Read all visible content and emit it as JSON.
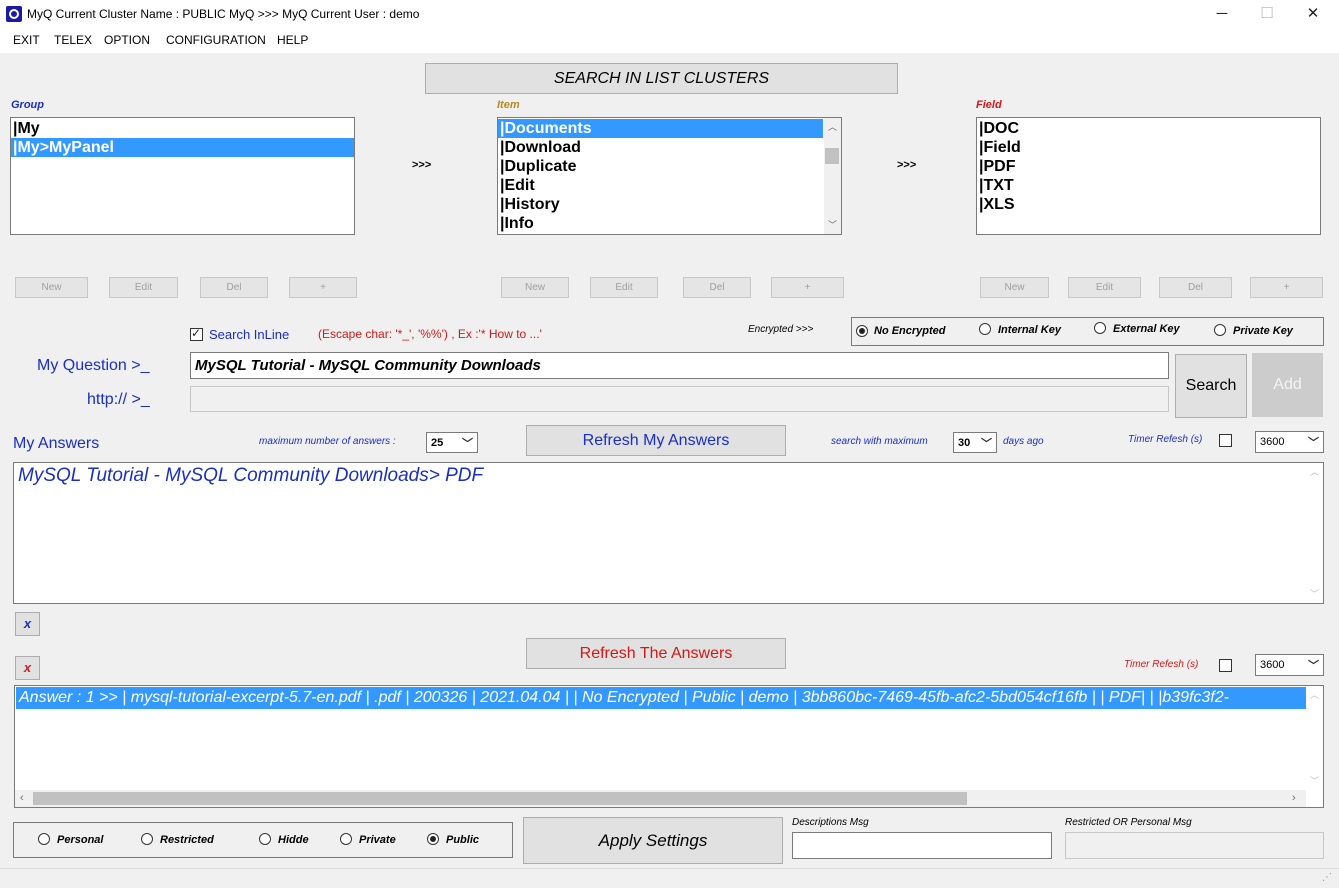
{
  "window": {
    "title": "MyQ Current Cluster Name : PUBLIC MyQ >>> MyQ Current User : demo",
    "minimize": "─",
    "maximize": "☐",
    "close": "✕"
  },
  "menu": [
    "EXIT",
    "TELEX",
    "OPTION",
    "CONFIGURATION",
    "HELP"
  ],
  "search_clusters_label": "SEARCH IN LIST CLUSTERS",
  "group": {
    "label": "Group",
    "items": [
      "|My",
      "|My>MyPanel"
    ],
    "selected": 1
  },
  "item": {
    "label": "Item",
    "items": [
      "|Documents",
      "|Download",
      "|Duplicate",
      "|Edit",
      "|History",
      "|Info"
    ],
    "selected": 0
  },
  "field": {
    "label": "Field",
    "items": [
      "|DOC",
      "|Field",
      "|PDF",
      "|TXT",
      "|XLS"
    ]
  },
  "arrow_sep": ">>>",
  "crud_buttons": [
    "New",
    "Edit",
    "Del",
    "+"
  ],
  "search_inline": {
    "label": "Search InLine",
    "checked": true,
    "hint": "(Escape char: '*_', '%%') , Ex :'* How to ...'"
  },
  "encryption": {
    "label": "Encrypted >>>",
    "options": [
      "No Encrypted",
      "Internal Key",
      "External Key",
      "Private Key"
    ],
    "selected": 0
  },
  "question": {
    "label": "My Question >_",
    "value": "MySQL Tutorial - MySQL Community Downloads"
  },
  "http": {
    "label": "http:// >_",
    "value": ""
  },
  "search_button": "Search",
  "add_button": "Add",
  "answers": {
    "label": "My Answers",
    "max_label": "maximum number of answers :",
    "max_value": "25",
    "refresh_label": "Refresh My Answers",
    "search_max_label": "search with maximum",
    "days_value": "30",
    "days_label": "days ago",
    "timer_label": "Timer Refesh (s)",
    "timer_value": "3600",
    "text": "MySQL Tutorial - MySQL Community Downloads> PDF"
  },
  "clear_label": "x",
  "the_answers": {
    "refresh_label": "Refresh The Answers",
    "timer_label": "Timer Refesh (s)",
    "timer_value": "3600",
    "row": "Answer : 1 >> | mysql-tutorial-excerpt-5.7-en.pdf | .pdf | 200326 | 2021.04.04 |  | No Encrypted | Public | demo | 3bb860bc-7469-45fb-afc2-5bd054cf16fb |  | PDF|   | |b39fc3f2-"
  },
  "visibility": {
    "options": [
      "Personal",
      "Restricted",
      "Hidde",
      "Private",
      "Public"
    ],
    "selected": 4
  },
  "apply_settings": "Apply Settings",
  "descriptions_msg_label": "Descriptions Msg",
  "restricted_msg_label": "Restricted OR Personal Msg",
  "colors": {
    "selection": "#3399ff",
    "blue_label": "#1a2ec4",
    "red_label": "#d21818",
    "gold_label": "#b58a1e"
  }
}
